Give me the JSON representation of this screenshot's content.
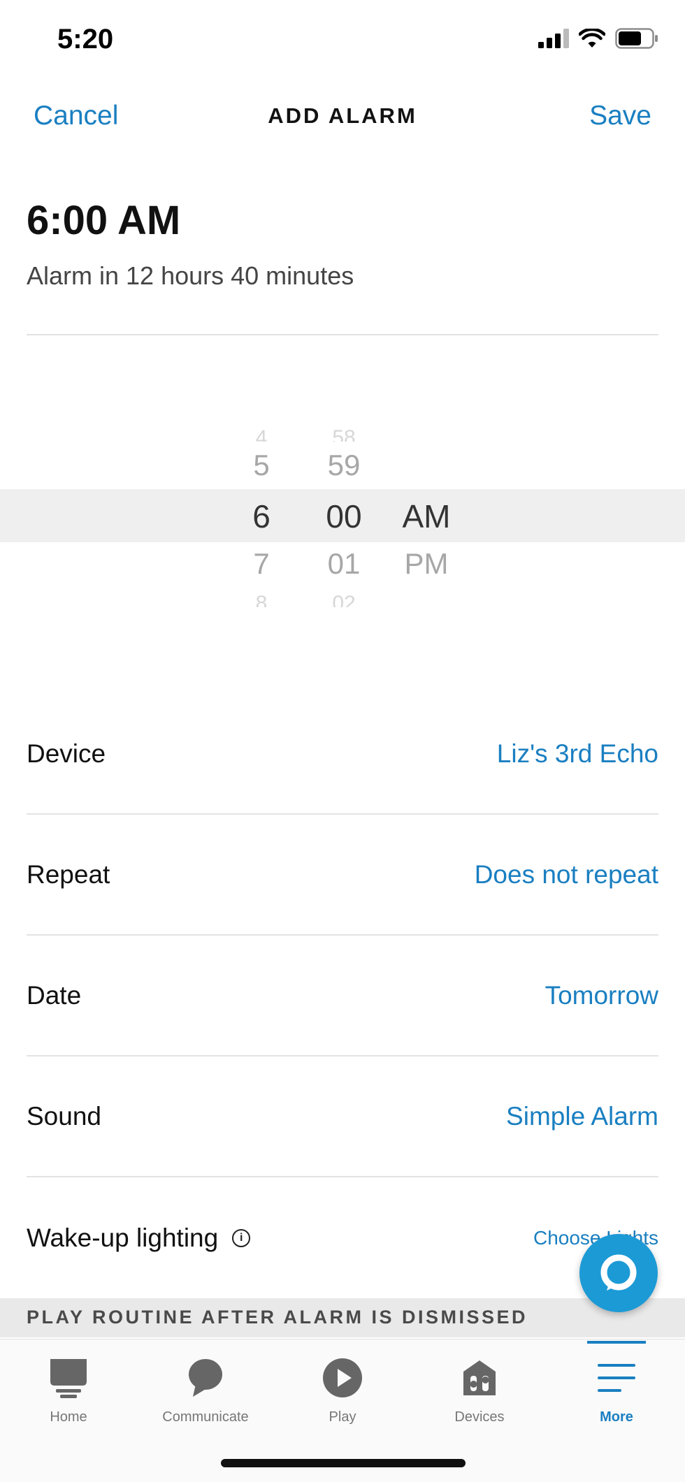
{
  "status_bar": {
    "time": "5:20"
  },
  "nav": {
    "cancel": "Cancel",
    "title": "ADD ALARM",
    "save": "Save"
  },
  "alarm": {
    "time": "6:00 AM",
    "subtitle": "Alarm in 12 hours 40 minutes"
  },
  "picker": {
    "hours": [
      "4",
      "5",
      "6",
      "7",
      "8"
    ],
    "minutes": [
      "58",
      "59",
      "00",
      "01",
      "02"
    ],
    "periods": [
      "AM",
      "PM"
    ],
    "selected": {
      "hour": "6",
      "minute": "00",
      "period": "AM"
    }
  },
  "settings": [
    {
      "label": "Device",
      "value": "Liz's 3rd Echo"
    },
    {
      "label": "Repeat",
      "value": "Does not repeat"
    },
    {
      "label": "Date",
      "value": "Tomorrow"
    },
    {
      "label": "Sound",
      "value": "Simple Alarm"
    }
  ],
  "wake_up": {
    "label": "Wake-up lighting",
    "action": "Choose Lights"
  },
  "routine_header": "PLAY ROUTINE AFTER ALARM IS DISMISSED",
  "tabs": [
    {
      "label": "Home",
      "icon": "home-icon"
    },
    {
      "label": "Communicate",
      "icon": "chat-bubble-icon"
    },
    {
      "label": "Play",
      "icon": "play-icon"
    },
    {
      "label": "Devices",
      "icon": "devices-house-icon"
    },
    {
      "label": "More",
      "icon": "menu-icon",
      "active": true
    }
  ],
  "colors": {
    "accent": "#1a7fc1",
    "alexa": "#1c9ad6"
  }
}
